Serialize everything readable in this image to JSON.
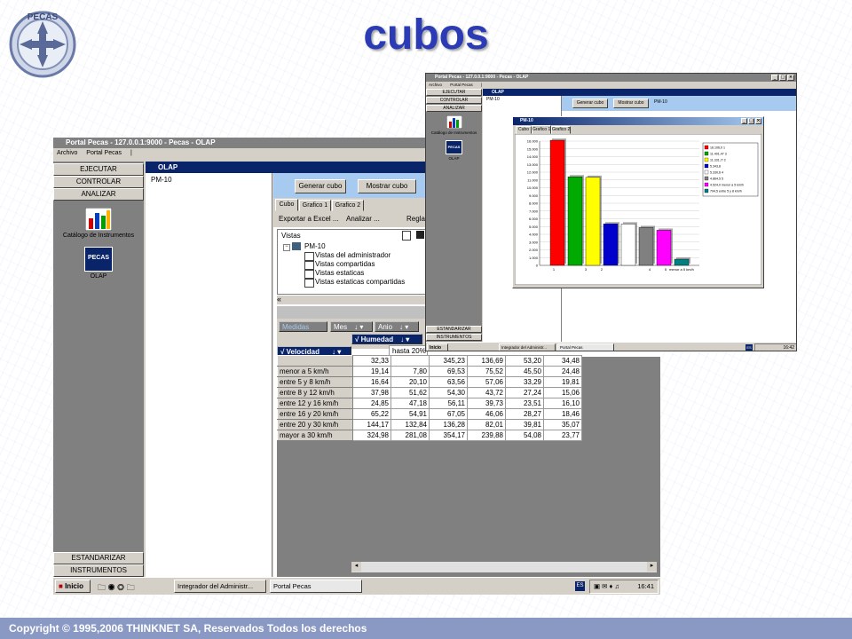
{
  "slide": {
    "title": "cubos",
    "logo_text": "PECAS",
    "footer": "Copyright © 1995,2006 THINKNET SA, Reservados Todos los derechos"
  },
  "main_window": {
    "title": "Portal Pecas - 127.0.0.1:9000 - Pecas - OLAP",
    "menu": [
      "Archivo",
      "Portal Pecas",
      "|"
    ],
    "sidebar_top": [
      "EJECUTAR",
      "CONTROLAR",
      "ANALIZAR"
    ],
    "sidebar_bottom": [
      "ESTANDARIZAR",
      "INSTRUMENTOS"
    ],
    "icons": [
      {
        "label": "Catálogo de Instrumentos",
        "icon": "catalog-chart-icon"
      },
      {
        "label": "OLAP",
        "icon": "pecas-cube-icon",
        "badge": "PECAS"
      }
    ],
    "olap_title": "OLAP",
    "tree_root": "PM-10",
    "buttons": {
      "generate": "Generar cubo",
      "show": "Mostrar cubo"
    },
    "tabs": [
      "Cubo",
      "Grafico 1",
      "Grafico 2"
    ],
    "toolbar": {
      "export": "Exportar a Excel ...",
      "analyze": "Analizar ...",
      "rules": "Regla"
    },
    "views": {
      "header": "Vistas",
      "root": "PM-10",
      "items": [
        "Vistas del administrador",
        "Vistas compartidas",
        "Vistas estaticas",
        "Vistas estaticas compartidas"
      ]
    },
    "pivot": {
      "page_fields": [
        "Mes",
        "Anio"
      ],
      "hidden_field": "Medidas",
      "row_field": "Velocidad",
      "column_field": "Humedad",
      "column_header": "hasta 20%",
      "rows": [
        {
          "label": "",
          "values": [
            "32,33",
            "",
            "345,23",
            "136,69",
            "53,20",
            "34,48"
          ]
        },
        {
          "label": "menor a 5 km/h",
          "values": [
            "19,14",
            "7,80",
            "69,53",
            "75,52",
            "45,50",
            "24,48"
          ]
        },
        {
          "label": "entre 5 y 8 km/h",
          "values": [
            "16,64",
            "20,10",
            "63,56",
            "57,06",
            "33,29",
            "19,81"
          ]
        },
        {
          "label": "entre 8 y 12 km/h",
          "values": [
            "37,98",
            "51,62",
            "54,30",
            "43,72",
            "27,24",
            "15,06"
          ]
        },
        {
          "label": "entre 12 y 16 km/h",
          "values": [
            "24,85",
            "47,18",
            "56,11",
            "39,73",
            "23,51",
            "16,10"
          ]
        },
        {
          "label": "entre 16 y 20 km/h",
          "values": [
            "65,22",
            "54,91",
            "67,05",
            "46,06",
            "28,27",
            "18,46"
          ]
        },
        {
          "label": "entre 20 y 30 km/h",
          "values": [
            "144,17",
            "132,84",
            "136,28",
            "82,01",
            "39,81",
            "35,07"
          ]
        },
        {
          "label": "mayor a 30 km/h",
          "values": [
            "324,98",
            "281,08",
            "354,17",
            "239,88",
            "54,08",
            "23,77"
          ]
        }
      ]
    },
    "taskbar": {
      "start": "Inicio",
      "items": [
        "Integrador del Administr...",
        "Portal Pecas"
      ],
      "lang": "ES",
      "time": "16:41"
    }
  },
  "overlay_window": {
    "title": "Portal Pecas - 127.0.0.1:9000 - Pecas - OLAP",
    "menu": [
      "Archivo",
      "Portal Pecas",
      "|"
    ],
    "sidebar_top": [
      "EJECUTAR",
      "CONTROLAR",
      "ANALIZAR"
    ],
    "sidebar_bottom": [
      "ESTANDARIZAR",
      "INSTRUMENTOS"
    ],
    "icons": [
      {
        "label": "Catálogo de Instrumentos"
      },
      {
        "label": "OLAP",
        "badge": "PECAS"
      }
    ],
    "olap_title": "OLAP",
    "tree_root": "PM-10",
    "buttons": {
      "generate": "Generar cubo",
      "show": "Mostrar cubo"
    },
    "selected": "PM-10",
    "taskbar": {
      "start": "Inicio",
      "items": [
        "Integrador del Administr...",
        "Portal Pecas"
      ],
      "lang": "ES",
      "time": "16:42"
    }
  },
  "chart_window": {
    "title": "PM-10",
    "tabs": [
      "Cubo",
      "Grafico 1",
      "Grafico 2"
    ]
  },
  "chart_data": {
    "type": "bar",
    "categories": [
      "1",
      "",
      "3",
      "2",
      "",
      "",
      "4",
      "5",
      "menor a 5 km/h",
      ""
    ],
    "values": [
      16106.1,
      11401.5,
      11331.7,
      5343.8,
      5330.6,
      4864.5,
      4524.0,
      794.5
    ],
    "colors": [
      "#ff0000",
      "#00aa00",
      "#ffff00",
      "#0000cc",
      "#ffffff",
      "#808080",
      "#ff00ff",
      "#008080"
    ],
    "legend": [
      "16.106,0 1",
      "11.401,47 3",
      "11.331,7/ 2",
      "5.343,8",
      "5.330,6 4",
      "4.864,5 5",
      "4.524,0 menor a 5 km/h",
      "794,5 entre 5 y 8 km/h"
    ],
    "ylim": [
      0,
      16000
    ],
    "yticks": [
      "0",
      "1.000",
      "2.000",
      "3.000",
      "4.000",
      "5.000",
      "6.000",
      "7.000",
      "8.000",
      "9.000",
      "10.000",
      "11.000",
      "12.000",
      "13.000",
      "14.000",
      "15.000",
      "16.000"
    ],
    "grid": true,
    "legend_position": "right"
  },
  "colors": {
    "title_blue": "#2a3bb5",
    "titlebar": "#0a246a",
    "face": "#d4d0c8",
    "sidebar": "#808080",
    "footer": "#8a99c4"
  }
}
